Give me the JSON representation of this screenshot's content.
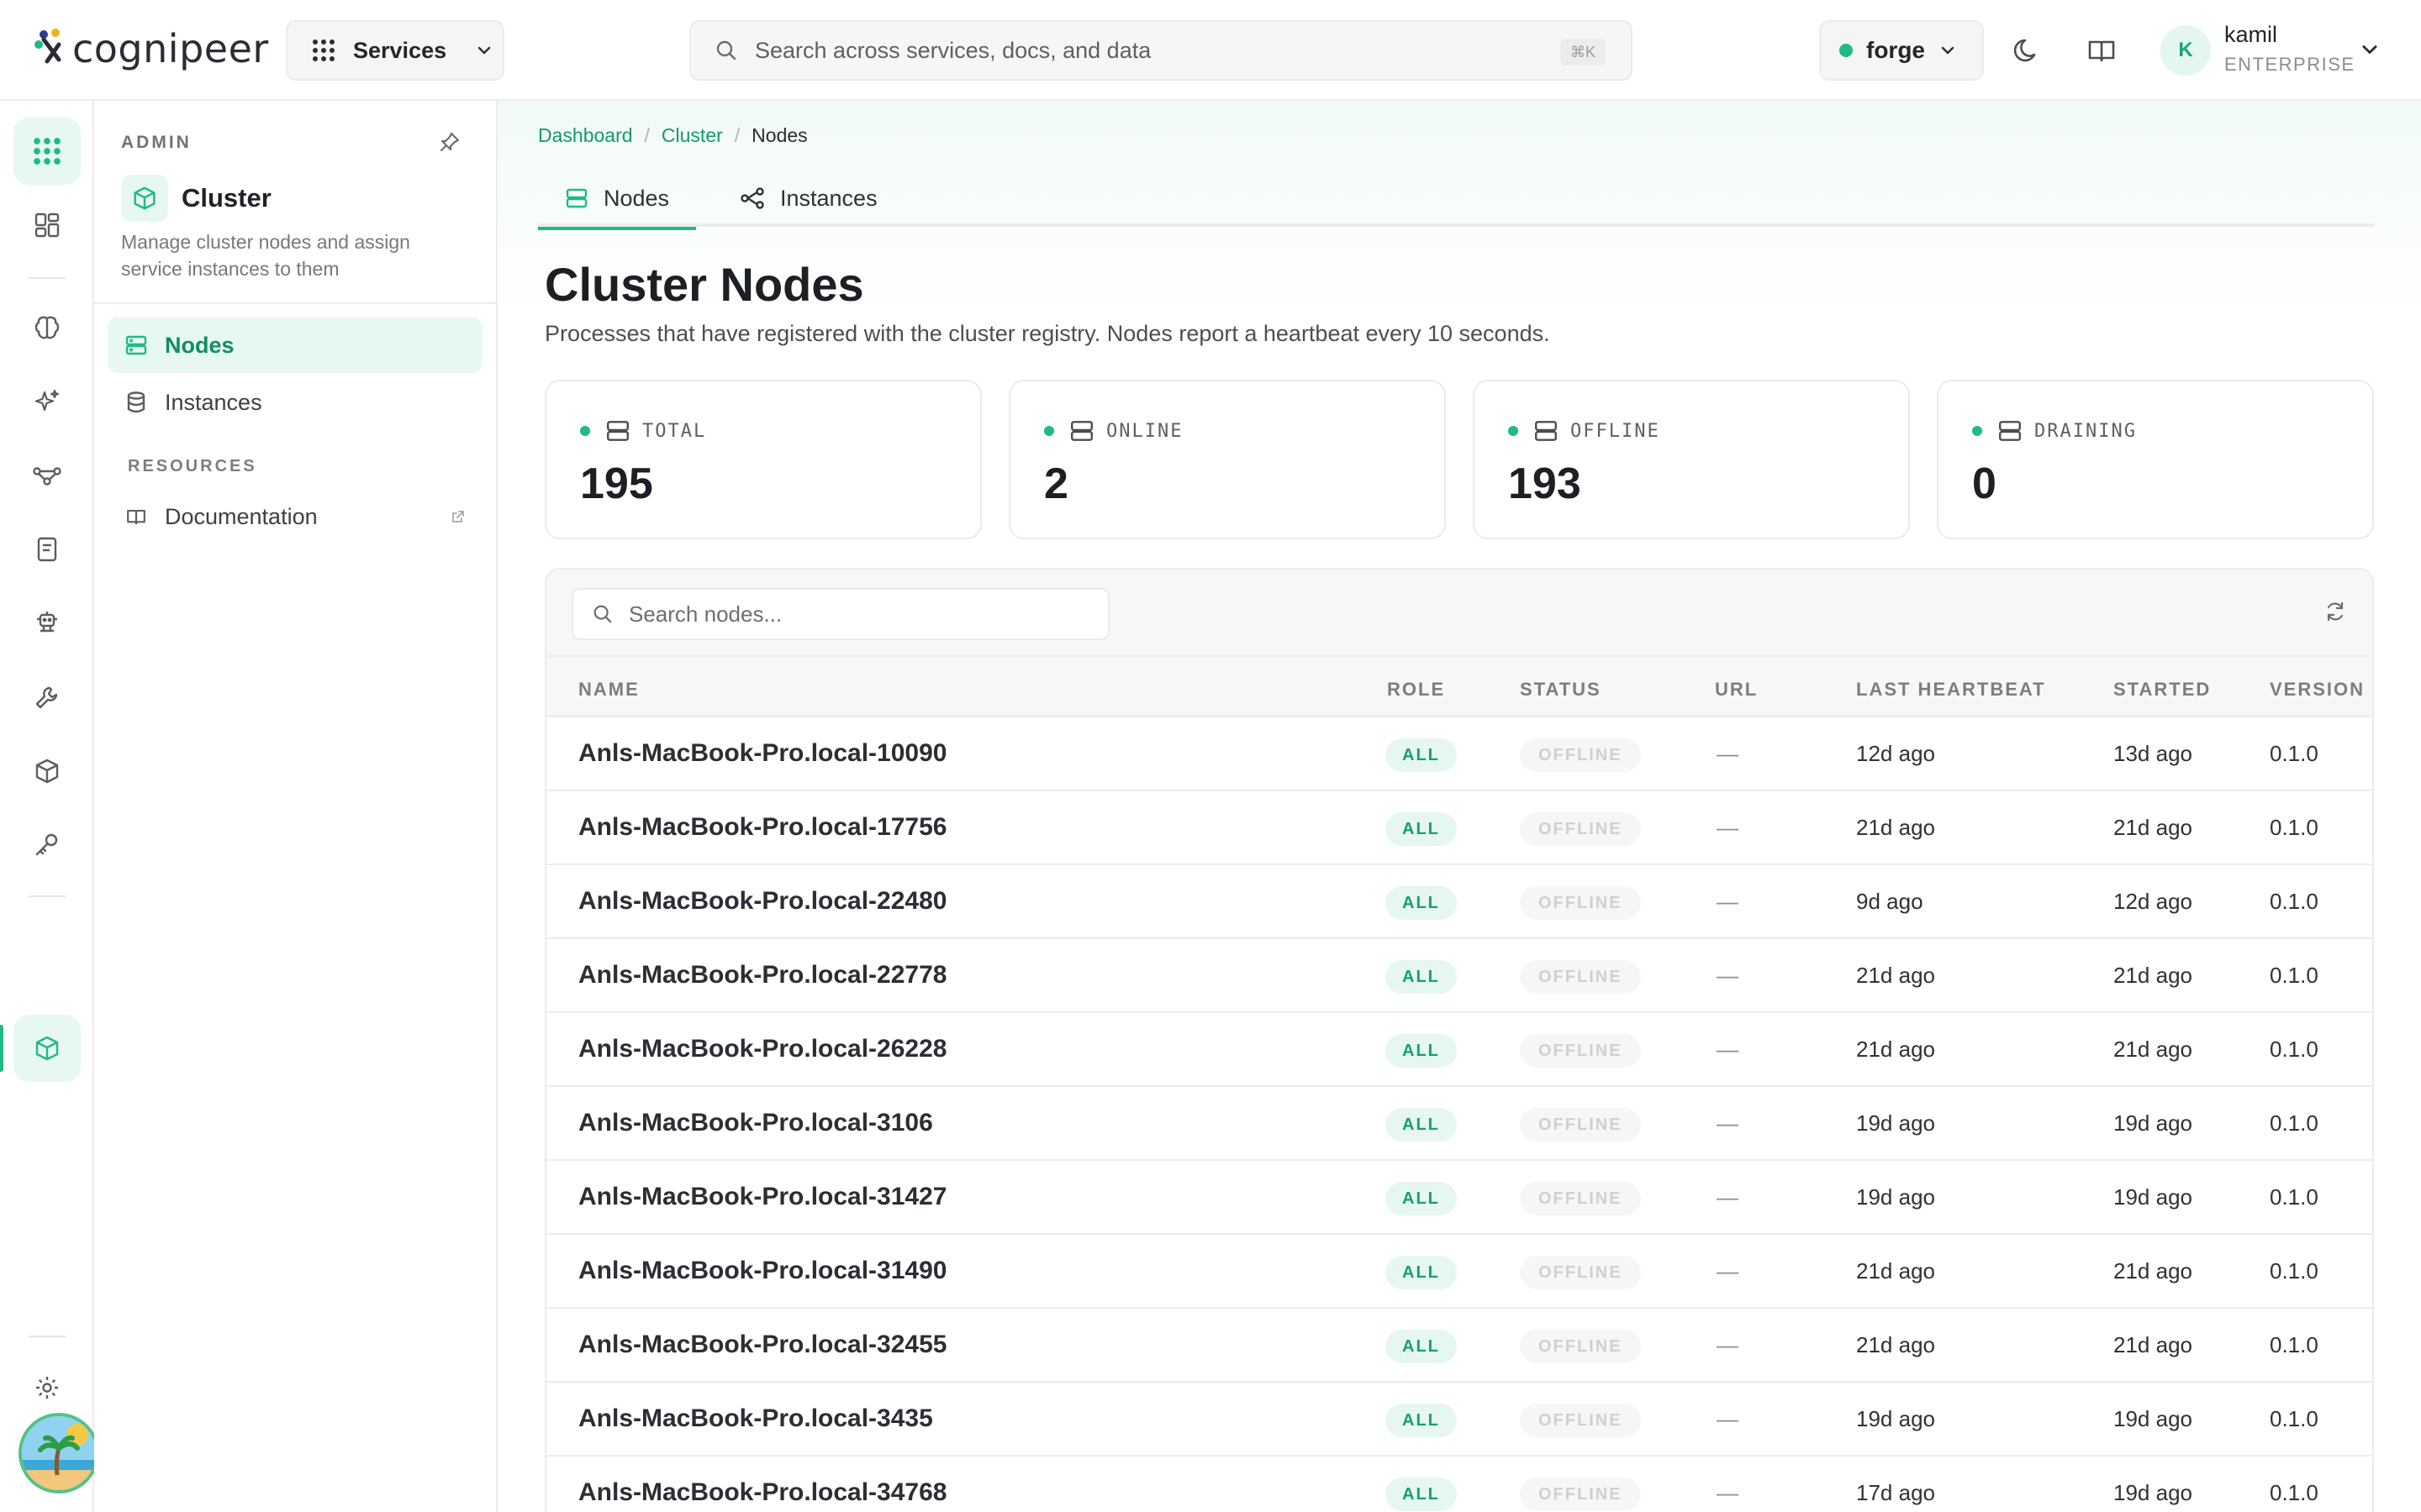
{
  "brand": {
    "name": "cognipeer"
  },
  "topbar": {
    "services_label": "Services",
    "search_placeholder": "Search across services, docs, and data",
    "search_shortcut": "⌘K",
    "workspace": "forge",
    "user": {
      "initial": "K",
      "name": "kamil",
      "plan": "ENTERPRISE"
    }
  },
  "rail": {
    "icons": [
      "apps-grid-icon",
      "dashboard-icon",
      "brain-icon",
      "sparkles-icon",
      "flow-icon",
      "notebook-icon",
      "agent-icon",
      "tools-icon",
      "cube-icon",
      "key-icon",
      "cluster-icon",
      "settings-icon"
    ]
  },
  "sidebar": {
    "section": "ADMIN",
    "title": "Cluster",
    "description": "Manage cluster nodes and assign service instances to them",
    "items": [
      {
        "label": "Nodes",
        "icon": "server-icon"
      },
      {
        "label": "Instances",
        "icon": "database-icon"
      }
    ],
    "resources_label": "RESOURCES",
    "resources": [
      {
        "label": "Documentation",
        "icon": "book-icon"
      }
    ]
  },
  "breadcrumb": {
    "items": [
      "Dashboard",
      "Cluster"
    ],
    "current": "Nodes"
  },
  "tabs": [
    {
      "label": "Nodes"
    },
    {
      "label": "Instances"
    }
  ],
  "page": {
    "title": "Cluster Nodes",
    "subtitle": "Processes that have registered with the cluster registry. Nodes report a heartbeat every 10 seconds."
  },
  "stats": [
    {
      "label": "TOTAL",
      "value": "195"
    },
    {
      "label": "ONLINE",
      "value": "2"
    },
    {
      "label": "OFFLINE",
      "value": "193"
    },
    {
      "label": "DRAINING",
      "value": "0"
    }
  ],
  "table": {
    "search_placeholder": "Search nodes...",
    "columns": [
      "NAME",
      "ROLE",
      "STATUS",
      "URL",
      "LAST HEARTBEAT",
      "STARTED",
      "VERSION"
    ],
    "rows": [
      {
        "name": "Anls-MacBook-Pro.local-10090",
        "role": "ALL",
        "status": "OFFLINE",
        "url": "—",
        "heartbeat": "12d ago",
        "started": "13d ago",
        "version": "0.1.0"
      },
      {
        "name": "Anls-MacBook-Pro.local-17756",
        "role": "ALL",
        "status": "OFFLINE",
        "url": "—",
        "heartbeat": "21d ago",
        "started": "21d ago",
        "version": "0.1.0"
      },
      {
        "name": "Anls-MacBook-Pro.local-22480",
        "role": "ALL",
        "status": "OFFLINE",
        "url": "—",
        "heartbeat": "9d ago",
        "started": "12d ago",
        "version": "0.1.0"
      },
      {
        "name": "Anls-MacBook-Pro.local-22778",
        "role": "ALL",
        "status": "OFFLINE",
        "url": "—",
        "heartbeat": "21d ago",
        "started": "21d ago",
        "version": "0.1.0"
      },
      {
        "name": "Anls-MacBook-Pro.local-26228",
        "role": "ALL",
        "status": "OFFLINE",
        "url": "—",
        "heartbeat": "21d ago",
        "started": "21d ago",
        "version": "0.1.0"
      },
      {
        "name": "Anls-MacBook-Pro.local-3106",
        "role": "ALL",
        "status": "OFFLINE",
        "url": "—",
        "heartbeat": "19d ago",
        "started": "19d ago",
        "version": "0.1.0"
      },
      {
        "name": "Anls-MacBook-Pro.local-31427",
        "role": "ALL",
        "status": "OFFLINE",
        "url": "—",
        "heartbeat": "19d ago",
        "started": "19d ago",
        "version": "0.1.0"
      },
      {
        "name": "Anls-MacBook-Pro.local-31490",
        "role": "ALL",
        "status": "OFFLINE",
        "url": "—",
        "heartbeat": "21d ago",
        "started": "21d ago",
        "version": "0.1.0"
      },
      {
        "name": "Anls-MacBook-Pro.local-32455",
        "role": "ALL",
        "status": "OFFLINE",
        "url": "—",
        "heartbeat": "21d ago",
        "started": "21d ago",
        "version": "0.1.0"
      },
      {
        "name": "Anls-MacBook-Pro.local-3435",
        "role": "ALL",
        "status": "OFFLINE",
        "url": "—",
        "heartbeat": "19d ago",
        "started": "19d ago",
        "version": "0.1.0"
      },
      {
        "name": "Anls-MacBook-Pro.local-34768",
        "role": "ALL",
        "status": "OFFLINE",
        "url": "—",
        "heartbeat": "17d ago",
        "started": "19d ago",
        "version": "0.1.0"
      }
    ]
  },
  "colors": {
    "accent": "#1fba85",
    "accent_text": "#139a6a",
    "accent_bg": "#e7f8f0",
    "border": "#ebebe8"
  }
}
